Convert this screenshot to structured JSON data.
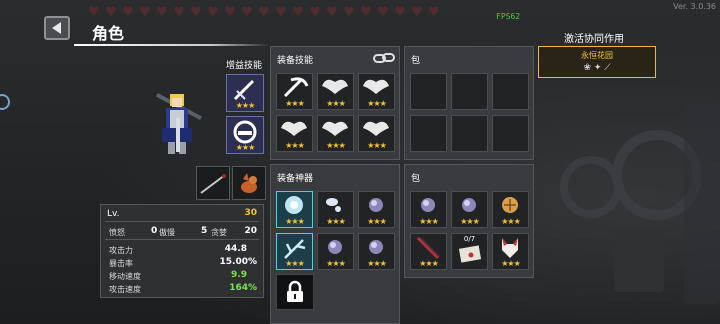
{
  "version": "Ver. 3.0.36",
  "fps": "FPS62",
  "header": {
    "title": "角色"
  },
  "buff_skills": {
    "label": "增益技能",
    "slots": [
      {
        "icon": "sword-buff-icon",
        "stars": "★★★"
      },
      {
        "icon": "helmet-buff-icon",
        "stars": "★★★"
      }
    ]
  },
  "weapons": [
    {
      "icon": "staff-icon"
    },
    {
      "icon": "fox-pet-icon"
    }
  ],
  "equip_skills": {
    "title": "装备技能",
    "link_icon": "chain-link-icon",
    "slots": [
      {
        "icon": "scythe-skill-icon",
        "stars": "★★★"
      },
      {
        "icon": "angel-wings-icon",
        "stars": "★★★"
      },
      {
        "icon": "angel-wings-icon",
        "stars": "★★★"
      },
      {
        "icon": "angel-wings-icon",
        "stars": "★★★"
      },
      {
        "icon": "angel-wings-icon",
        "stars": "★★★"
      },
      {
        "icon": "angel-wings-icon",
        "stars": "★★★"
      }
    ]
  },
  "bag_top": {
    "title": "包"
  },
  "equip_artifacts": {
    "title": "装备神器",
    "slots": [
      {
        "icon": "crystal-flower-icon",
        "stars": "★★★",
        "highlight": true
      },
      {
        "icon": "cloud-orb-icon",
        "stars": "★★★",
        "highlight": false
      },
      {
        "icon": "purple-orb-icon",
        "stars": "★★★",
        "highlight": false
      },
      {
        "icon": "ice-branch-icon",
        "stars": "★★★",
        "highlight": true
      },
      {
        "icon": "purple-orb-icon",
        "stars": "★★★",
        "highlight": false
      },
      {
        "icon": "purple-orb-icon",
        "stars": "★★★",
        "highlight": false
      }
    ],
    "lock_icon": "padlock-icon"
  },
  "bag_bottom": {
    "title": "包",
    "slots": [
      {
        "icon": "purple-orb-icon",
        "stars": "★★★",
        "count": ""
      },
      {
        "icon": "purple-orb-icon",
        "stars": "★★★",
        "count": ""
      },
      {
        "icon": "golden-shield-icon",
        "stars": "★★★",
        "count": ""
      },
      {
        "icon": "red-blade-icon",
        "stars": "★★★",
        "count": ""
      },
      {
        "icon": "letter-icon",
        "stars": "",
        "count": "0/7"
      },
      {
        "icon": "fox-mask-icon",
        "stars": "★★★",
        "count": ""
      }
    ]
  },
  "stats": {
    "level_label": "Lv.",
    "level_value": "30",
    "row1": [
      {
        "label": "愤怒",
        "value": "0"
      },
      {
        "label": "傲慢",
        "value": "5"
      },
      {
        "label": "贪婪",
        "value": "20"
      }
    ],
    "attack_label": "攻击力",
    "attack_value": "44.8",
    "crit_label": "暴击率",
    "crit_value": "15.00%",
    "move_label": "移动速度",
    "move_value": "9.9",
    "atkspd_label": "攻击速度",
    "atkspd_value": "164%"
  },
  "synergy": {
    "title": "激活协同作用",
    "name": "永恒花园",
    "icons": "❀ ✦ ⟋"
  },
  "colors": {
    "gold": "#f4c430",
    "green": "#7be34a",
    "cyan": "#3fd6e8",
    "yellow": "#f5c34a"
  }
}
